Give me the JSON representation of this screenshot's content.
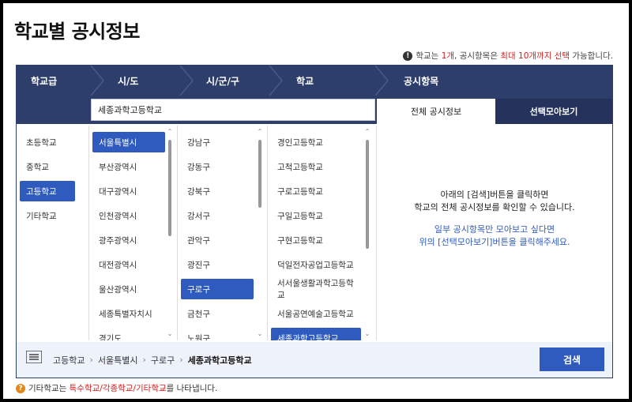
{
  "page": {
    "title": "학교별 공시정보"
  },
  "notice": {
    "part1": "학교는 ",
    "part2": "1개",
    "part3": ", 공시항목은 ",
    "part4": "최대 10개까지 선택",
    "part5": " 가능합니다."
  },
  "header": {
    "school_level": "학교급",
    "city": "시/도",
    "district": "시/군/구",
    "school": "학교",
    "items": "공시항목"
  },
  "selected_school": "세종과학고등학교",
  "tabs": {
    "all": "전체 공시정보",
    "collected": "선택모아보기"
  },
  "school_levels": [
    "초등학교",
    "중학교",
    "고등학교",
    "기타학교"
  ],
  "school_level_active": 2,
  "cities": [
    "서울특별시",
    "부산광역시",
    "대구광역시",
    "인천광역시",
    "광주광역시",
    "대전광역시",
    "울산광역시",
    "세종특별자치시",
    "경기도"
  ],
  "city_active": 0,
  "districts": [
    "강남구",
    "강동구",
    "강북구",
    "강서구",
    "관악구",
    "광진구",
    "구로구",
    "금천구",
    "노원구"
  ],
  "district_active": 6,
  "schools": [
    "경인고등학교",
    "고척고등학교",
    "구로고등학교",
    "구일고등학교",
    "구현고등학교",
    "덕일전자공업고등학교",
    "서서울생활과학고등학교",
    "서울공연예술고등학교",
    "세종과학고등학교"
  ],
  "school_active": 8,
  "info": {
    "line1a": "아래의 [검색]버튼을 클릭하면",
    "line1b": "학교의 전체 공시정보를 확인할 수 있습니다.",
    "line2a": "일부 공시항목만 모아보고 싶다면",
    "line2b": "위의 [선택모아보기]버튼을 클릭해주세요."
  },
  "breadcrumb": [
    "고등학교",
    "서울특별시",
    "구로구",
    "세종과학고등학교"
  ],
  "search_label": "검색",
  "bottom_note": {
    "part1": "기타학교는 ",
    "part2": "특수학교/각종학교/기타학교",
    "part3": "를 나타냅니다."
  },
  "colors": {
    "header": "#2e3e6b",
    "active": "#2e5bbd",
    "accent_red": "#d62020"
  },
  "icons": {
    "info": "info-icon",
    "menu": "menu-icon",
    "help": "question-icon"
  }
}
